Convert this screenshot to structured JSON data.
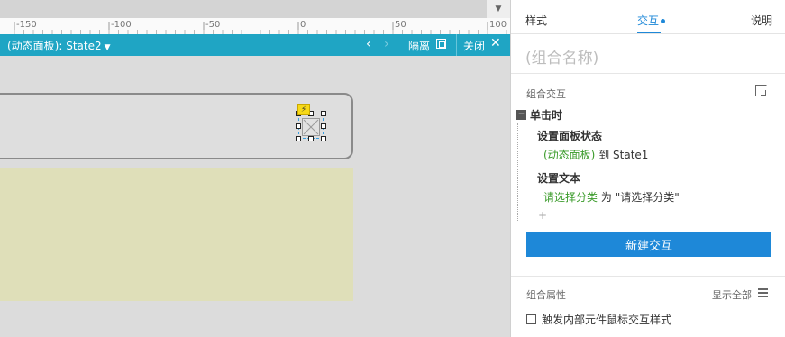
{
  "ruler": {
    "ticks": [
      "-150",
      "-100",
      "-50",
      "0",
      "50",
      "100"
    ]
  },
  "panel_bar": {
    "title": "(动态面板): State2",
    "isolate_label": "隔离",
    "close_label": "关闭",
    "color": "#1fa5c4"
  },
  "inspector": {
    "tabs": {
      "style": "样式",
      "interactions": "交互",
      "notes": "说明"
    },
    "group_name_placeholder": "(组合名称)",
    "interactions_section_label": "组合交互",
    "event": {
      "label": "单击时",
      "actions": [
        {
          "title": "设置面板状态",
          "target": "(动态面板)",
          "connector": "到",
          "value": "State1"
        },
        {
          "title": "设置文本",
          "target": "请选择分类",
          "connector": "为",
          "value": "\"请选择分类\""
        }
      ]
    },
    "add_action": "+",
    "new_interaction_button": "新建交互",
    "accent_color": "#1e88d8",
    "properties_label": "组合属性",
    "show_all": "显示全部",
    "checkbox_label": "触发内部元件鼠标交互样式"
  }
}
